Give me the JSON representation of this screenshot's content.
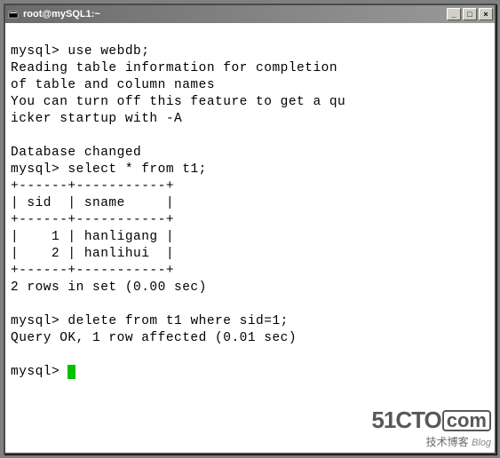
{
  "titlebar": {
    "text": "root@mySQL1:~"
  },
  "controls": {
    "minimize": "_",
    "maximize": "□",
    "close": "×"
  },
  "terminal": {
    "prompt": "mysql>",
    "cmd1": "use webdb;",
    "response1_l1": "Reading table information for completion",
    "response1_l2": "of table and column names",
    "response1_l3": "You can turn off this feature to get a qu",
    "response1_l4": "icker startup with -A",
    "response1_l5": "Database changed",
    "cmd2": "select * from t1;",
    "table_border": "+------+-----------+",
    "table_header": "| sid  | sname     |",
    "table_row1": "|    1 | hanligang |",
    "table_row2": "|    2 | hanlihui  |",
    "rows_msg": "2 rows in set (0.00 sec)",
    "cmd3": "delete from t1 where sid=1;",
    "response3": "Query OK, 1 row affected (0.01 sec)"
  },
  "watermark": {
    "main": "51CTO",
    "dot": "com",
    "sub": "技术博客",
    "blog": "Blog"
  }
}
